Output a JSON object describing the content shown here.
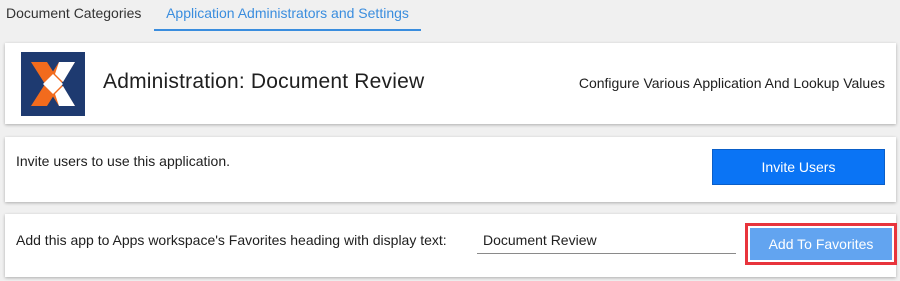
{
  "tabs": [
    {
      "label": "Document Categories",
      "active": false
    },
    {
      "label": "Application Administrators and Settings",
      "active": true
    }
  ],
  "header": {
    "title": "Administration: Document Review",
    "subtitle": "Configure Various Application And Lookup Values",
    "logo_icon": "app-logo-x-icon"
  },
  "invite": {
    "text": "Invite users to use this application.",
    "button_label": "Invite Users"
  },
  "favorites": {
    "text": "Add this app to Apps workspace's Favorites heading with display text:",
    "input_value": "Document Review",
    "button_label": "Add To Favorites",
    "highlighted": true
  },
  "colors": {
    "accent": "#3a8dde",
    "primary_button": "#0a74f5",
    "favorites_button": "#62a4f0",
    "highlight_border": "#e8343c",
    "logo_background": "#1e3a70",
    "logo_orange": "#f26b1d"
  }
}
